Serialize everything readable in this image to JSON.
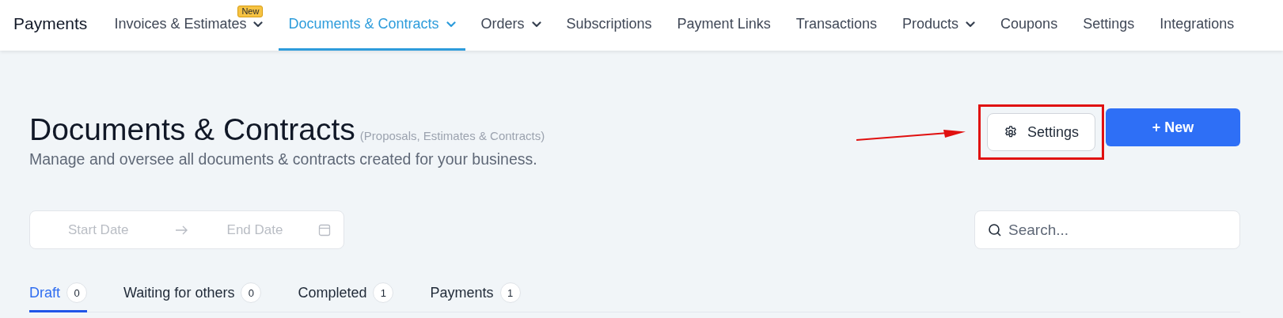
{
  "app_title": "Payments",
  "nav": [
    {
      "label": "Invoices & Estimates",
      "dropdown": true,
      "badge": "New",
      "selected": false
    },
    {
      "label": "Documents & Contracts",
      "dropdown": true,
      "selected": true
    },
    {
      "label": "Orders",
      "dropdown": true,
      "selected": false
    },
    {
      "label": "Subscriptions",
      "dropdown": false,
      "selected": false
    },
    {
      "label": "Payment Links",
      "dropdown": false,
      "selected": false
    },
    {
      "label": "Transactions",
      "dropdown": false,
      "selected": false
    },
    {
      "label": "Products",
      "dropdown": true,
      "selected": false
    },
    {
      "label": "Coupons",
      "dropdown": false,
      "selected": false
    },
    {
      "label": "Settings",
      "dropdown": false,
      "selected": false
    },
    {
      "label": "Integrations",
      "dropdown": false,
      "selected": false
    }
  ],
  "header": {
    "title": "Documents & Contracts",
    "title_note": "(Proposals, Estimates & Contracts)",
    "subtitle": "Manage and oversee all documents & contracts created for your business."
  },
  "actions": {
    "settings_button": "Settings",
    "new_button": "+ New",
    "highlight_settings": true
  },
  "date_range": {
    "start_placeholder": "Start Date",
    "end_placeholder": "End Date"
  },
  "search": {
    "placeholder": "Search..."
  },
  "tabs": [
    {
      "label": "Draft",
      "count": "0",
      "selected": true
    },
    {
      "label": "Waiting for others",
      "count": "0",
      "selected": false
    },
    {
      "label": "Completed",
      "count": "1",
      "selected": false
    },
    {
      "label": "Payments",
      "count": "1",
      "selected": false
    }
  ]
}
